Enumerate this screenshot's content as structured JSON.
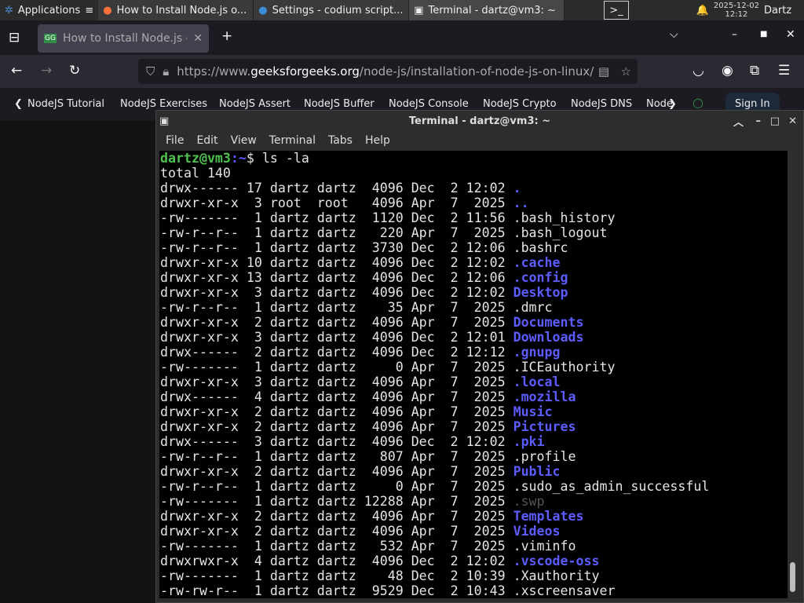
{
  "panel": {
    "applications": "Applications",
    "tasks": [
      "How to Install Node.js o...",
      "Settings - codium script...",
      "Terminal - dartz@vm3: ~"
    ],
    "date": "2025-12-02",
    "time": "12:12",
    "user": "Dartz"
  },
  "browser": {
    "tab_title": "How to Install Node.js or",
    "url_prefix": "https://www.",
    "url_domain": "geeksforgeeks.org",
    "url_path": "/node-js/installation-of-node-js-on-linux/",
    "bookmarks": [
      "NodeJS Tutorial",
      "NodeJS Exercises",
      "NodeJS Assert",
      "NodeJS Buffer",
      "NodeJS Console",
      "NodeJS Crypto",
      "NodeJS DNS",
      "Node"
    ],
    "sign_in": "Sign In"
  },
  "terminal": {
    "title": "Terminal - dartz@vm3: ~",
    "menu": [
      "File",
      "Edit",
      "View",
      "Terminal",
      "Tabs",
      "Help"
    ],
    "prompt_user": "dartz@vm3",
    "prompt_path": ":~",
    "prompt_sym": "$ ",
    "command": "ls -la",
    "total": "total 140",
    "entries": [
      [
        "drwx------ 17 dartz dartz  4096 Dec  2 12:02 ",
        ".",
        "dir"
      ],
      [
        "drwxr-xr-x  3 root  root   4096 Apr  7  2025 ",
        "..",
        "dir"
      ],
      [
        "-rw-------  1 dartz dartz  1120 Dec  2 11:56 ",
        ".bash_history",
        "file"
      ],
      [
        "-rw-r--r--  1 dartz dartz   220 Apr  7  2025 ",
        ".bash_logout",
        "file"
      ],
      [
        "-rw-r--r--  1 dartz dartz  3730 Dec  2 12:06 ",
        ".bashrc",
        "file"
      ],
      [
        "drwxr-xr-x 10 dartz dartz  4096 Dec  2 12:02 ",
        ".cache",
        "dir"
      ],
      [
        "drwxr-xr-x 13 dartz dartz  4096 Dec  2 12:06 ",
        ".config",
        "dir"
      ],
      [
        "drwxr-xr-x  3 dartz dartz  4096 Dec  2 12:02 ",
        "Desktop",
        "dir"
      ],
      [
        "-rw-r--r--  1 dartz dartz    35 Apr  7  2025 ",
        ".dmrc",
        "file"
      ],
      [
        "drwxr-xr-x  2 dartz dartz  4096 Apr  7  2025 ",
        "Documents",
        "dir"
      ],
      [
        "drwxr-xr-x  3 dartz dartz  4096 Dec  2 12:01 ",
        "Downloads",
        "dir"
      ],
      [
        "drwx------  2 dartz dartz  4096 Dec  2 12:12 ",
        ".gnupg",
        "dir"
      ],
      [
        "-rw-------  1 dartz dartz     0 Apr  7  2025 ",
        ".ICEauthority",
        "file"
      ],
      [
        "drwxr-xr-x  3 dartz dartz  4096 Apr  7  2025 ",
        ".local",
        "dir"
      ],
      [
        "drwx------  4 dartz dartz  4096 Apr  7  2025 ",
        ".mozilla",
        "dir"
      ],
      [
        "drwxr-xr-x  2 dartz dartz  4096 Apr  7  2025 ",
        "Music",
        "dir"
      ],
      [
        "drwxr-xr-x  2 dartz dartz  4096 Apr  7  2025 ",
        "Pictures",
        "dir"
      ],
      [
        "drwx------  3 dartz dartz  4096 Dec  2 12:02 ",
        ".pki",
        "dir"
      ],
      [
        "-rw-r--r--  1 dartz dartz   807 Apr  7  2025 ",
        ".profile",
        "file"
      ],
      [
        "drwxr-xr-x  2 dartz dartz  4096 Apr  7  2025 ",
        "Public",
        "dir"
      ],
      [
        "-rw-r--r--  1 dartz dartz     0 Apr  7  2025 ",
        ".sudo_as_admin_successful",
        "file"
      ],
      [
        "-rw-------  1 dartz dartz 12288 Apr  7  2025 ",
        ".swp",
        "dim"
      ],
      [
        "drwxr-xr-x  2 dartz dartz  4096 Apr  7  2025 ",
        "Templates",
        "dir"
      ],
      [
        "drwxr-xr-x  2 dartz dartz  4096 Apr  7  2025 ",
        "Videos",
        "dir"
      ],
      [
        "-rw-------  1 dartz dartz   532 Apr  7  2025 ",
        ".viminfo",
        "file"
      ],
      [
        "drwxrwxr-x  4 dartz dartz  4096 Dec  2 12:02 ",
        ".vscode-oss",
        "dir"
      ],
      [
        "-rw-------  1 dartz dartz    48 Dec  2 10:39 ",
        ".Xauthority",
        "file"
      ],
      [
        "-rw-rw-r--  1 dartz dartz  9529 Dec  2 10:43 ",
        ".xscreensaver",
        "file"
      ]
    ],
    "scroll_position": 0.97
  }
}
